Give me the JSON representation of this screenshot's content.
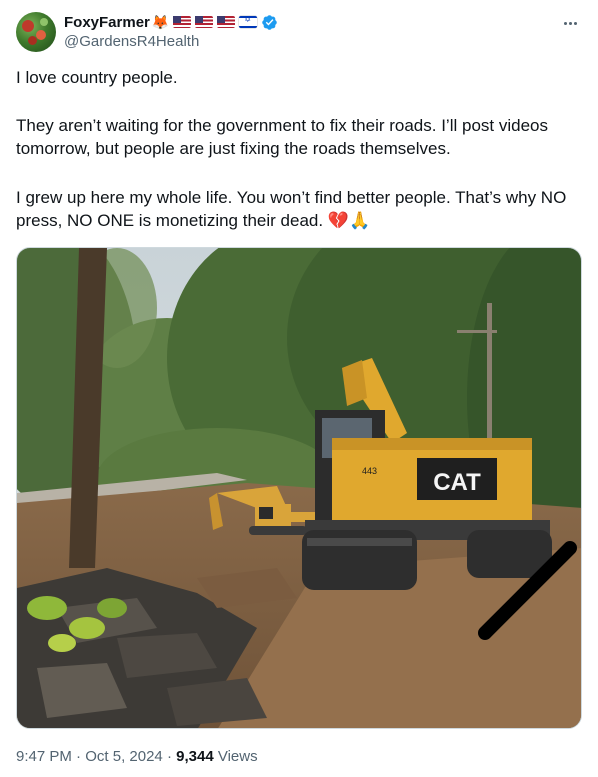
{
  "author": {
    "display_name": "FoxyFarmer",
    "handle": "@GardensR4Health",
    "name_emojis": [
      "fox-emoji",
      "us-flag",
      "us-flag",
      "us-flag",
      "israel-flag"
    ],
    "fox_glyph": "🦊",
    "verified_color": "#1d9bf0"
  },
  "post": {
    "paragraphs": [
      "I love country people.",
      "They aren’t waiting for the government to fix their roads. I’ll post videos tomorrow, but people are just fixing the roads themselves.",
      "I grew up here my whole life. You won’t find better people. That’s why NO press, NO ONE is monetizing their dead. 💔🙏"
    ],
    "image": {
      "excavator_main": {
        "brand": "CAT",
        "model": "443",
        "color": "#e0a82e"
      },
      "excavator_small": {
        "color": "#d9a43a"
      }
    }
  },
  "footer": {
    "time": "9:47 PM",
    "separator": "·",
    "date": "Oct 5, 2024",
    "views_count": "9,344",
    "views_label": "Views"
  },
  "colors": {
    "text_primary": "#0f1419",
    "text_secondary": "#536471",
    "border": "#cfd9de"
  }
}
